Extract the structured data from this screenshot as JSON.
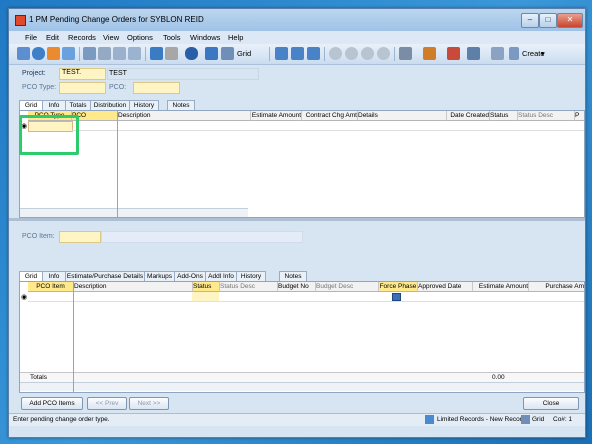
{
  "window": {
    "title": "1 PM Pending Change Orders for SYBLON REID"
  },
  "menu": [
    "File",
    "Edit",
    "Records",
    "View",
    "Options",
    "Tools",
    "Windows",
    "Help"
  ],
  "toolbar": {
    "grid_label": "Grid",
    "create_label": "Create"
  },
  "header": {
    "project_label": "Project:",
    "project_value": "TEST.",
    "project_desc": "TEST",
    "pco_type_label": "PCO Type:",
    "pco_label": "PCO:"
  },
  "top_tabs": [
    "Grid",
    "Info",
    "Totals",
    "Distribution",
    "History",
    "Notes"
  ],
  "top_grid": {
    "left_cols": [
      "PCO Type",
      "PCO"
    ],
    "right_cols": [
      "Description",
      "Estimate Amount",
      "Contract Chg Amt",
      "Details",
      "Date Created",
      "Status",
      "Status Desc",
      "P"
    ]
  },
  "item": {
    "label": "PCO Item:"
  },
  "bottom_tabs": [
    "Grid",
    "Info",
    "Estimate/Purchase Details",
    "Markups",
    "Add-Ons",
    "Addl Info",
    "History",
    "Notes"
  ],
  "bottom_grid": {
    "left_cols": [
      "PCO Item"
    ],
    "right_cols": [
      "Description",
      "Status",
      "Status Desc",
      "Budget No",
      "Budget Desc",
      "Force Phase",
      "Approved Date",
      "Estimate Amount",
      "Purchase Am"
    ],
    "totals_label": "Totals",
    "total_value": "0.00"
  },
  "buttons": {
    "add": "Add PCO Items",
    "prev": "<< Prev",
    "next": "Next >>",
    "close": "Close"
  },
  "status": {
    "message": "Enter pending change order type.",
    "records": "Limited Records - New Record",
    "grid": "Grid",
    "co": "Co#: 1"
  },
  "colors": {
    "accent": "#2ccc6c",
    "required_field": "#fff5c4"
  }
}
